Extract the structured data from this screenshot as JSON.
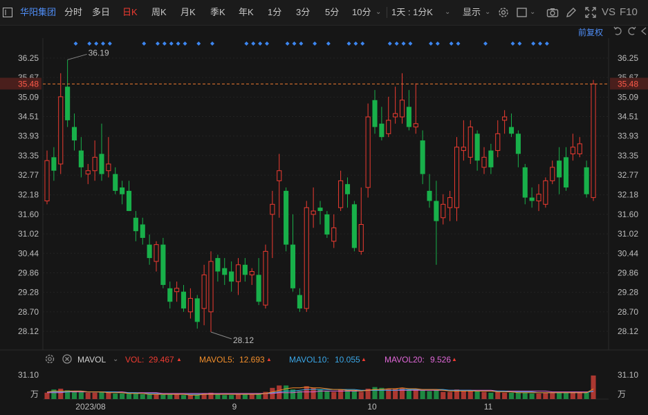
{
  "toolbar": {
    "stock_name": "华阳集团",
    "periods": [
      "分时",
      "多日",
      "日K",
      "周K",
      "月K",
      "季K",
      "年K",
      "1分",
      "3分",
      "5分",
      "10分"
    ],
    "active_period": "日K",
    "interval_select": "1天 : 1分K",
    "display_label": "显示",
    "compare_label": "VS",
    "f10_label": "F10"
  },
  "adjust_label": "前复权",
  "price_axis": {
    "ticks": [
      "36.25",
      "35.67",
      "35.09",
      "34.51",
      "33.93",
      "33.35",
      "32.77",
      "32.18",
      "31.60",
      "31.02",
      "30.44",
      "29.86",
      "29.28",
      "28.70",
      "28.12"
    ],
    "current_price": "35.48",
    "high_label": "36.19",
    "low_label": "28.12"
  },
  "volume_panel": {
    "indicator": "MAVOL",
    "vol_label": "VOL:",
    "vol_value": "29.467",
    "mavol5_label": "MAVOL5:",
    "mavol5_value": "12.693",
    "mavol10_label": "MAVOL10:",
    "mavol10_value": "10.055",
    "mavol20_label": "MAVOL20:",
    "mavol20_value": "9.526",
    "axis_top": "31.10",
    "axis_unit": "万"
  },
  "x_axis": [
    "2023/08",
    "9",
    "10",
    "11"
  ],
  "colors": {
    "up": "#ef3b31",
    "down": "#18b04a",
    "mavol5": "#f28e2b",
    "mavol10": "#3aa7e8",
    "mavol20": "#e067d8"
  },
  "chart_data": {
    "type": "candlestick",
    "ylim": [
      27.9,
      36.6
    ],
    "candles": [
      {
        "o": 32.0,
        "c": 33.2,
        "h": 33.5,
        "l": 31.9
      },
      {
        "o": 33.3,
        "c": 32.9,
        "h": 33.6,
        "l": 32.6
      },
      {
        "o": 33.1,
        "c": 35.1,
        "h": 35.8,
        "l": 32.8
      },
      {
        "o": 35.4,
        "c": 34.4,
        "h": 36.2,
        "l": 34.2
      },
      {
        "o": 34.2,
        "c": 33.8,
        "h": 34.6,
        "l": 33.5
      },
      {
        "o": 33.5,
        "c": 33.0,
        "h": 33.9,
        "l": 32.7
      },
      {
        "o": 32.8,
        "c": 32.9,
        "h": 33.1,
        "l": 32.5
      },
      {
        "o": 32.9,
        "c": 33.3,
        "h": 33.8,
        "l": 32.6
      },
      {
        "o": 33.4,
        "c": 32.8,
        "h": 34.3,
        "l": 32.6
      },
      {
        "o": 32.9,
        "c": 33.1,
        "h": 33.9,
        "l": 32.7
      },
      {
        "o": 32.8,
        "c": 32.3,
        "h": 33.0,
        "l": 32.2
      },
      {
        "o": 32.4,
        "c": 32.2,
        "h": 32.6,
        "l": 31.9
      },
      {
        "o": 32.3,
        "c": 31.7,
        "h": 32.6,
        "l": 31.7
      },
      {
        "o": 31.5,
        "c": 31.1,
        "h": 31.7,
        "l": 30.8
      },
      {
        "o": 31.3,
        "c": 30.9,
        "h": 31.5,
        "l": 30.7
      },
      {
        "o": 30.7,
        "c": 30.3,
        "h": 31.0,
        "l": 30.1
      },
      {
        "o": 30.2,
        "c": 30.7,
        "h": 30.8,
        "l": 29.9
      },
      {
        "o": 30.7,
        "c": 29.5,
        "h": 30.9,
        "l": 29.4
      },
      {
        "o": 29.4,
        "c": 29.0,
        "h": 29.6,
        "l": 28.8
      },
      {
        "o": 29.3,
        "c": 29.4,
        "h": 29.6,
        "l": 29.0
      },
      {
        "o": 29.3,
        "c": 28.8,
        "h": 29.5,
        "l": 28.7
      },
      {
        "o": 28.7,
        "c": 29.1,
        "h": 29.4,
        "l": 28.5
      },
      {
        "o": 29.1,
        "c": 28.4,
        "h": 29.2,
        "l": 28.2
      },
      {
        "o": 28.8,
        "c": 29.8,
        "h": 30.1,
        "l": 28.3
      },
      {
        "o": 28.7,
        "c": 30.2,
        "h": 30.5,
        "l": 28.1
      },
      {
        "o": 30.3,
        "c": 29.9,
        "h": 30.4,
        "l": 29.6
      },
      {
        "o": 30.0,
        "c": 29.8,
        "h": 30.3,
        "l": 29.5
      },
      {
        "o": 29.9,
        "c": 29.6,
        "h": 30.2,
        "l": 29.3
      },
      {
        "o": 29.6,
        "c": 30.1,
        "h": 30.3,
        "l": 29.2
      },
      {
        "o": 30.1,
        "c": 29.8,
        "h": 30.3,
        "l": 29.6
      },
      {
        "o": 29.8,
        "c": 29.9,
        "h": 30.0,
        "l": 29.5
      },
      {
        "o": 29.8,
        "c": 29.0,
        "h": 30.3,
        "l": 28.9
      },
      {
        "o": 28.9,
        "c": 30.5,
        "h": 30.7,
        "l": 28.8
      },
      {
        "o": 31.6,
        "c": 31.9,
        "h": 32.3,
        "l": 30.3
      },
      {
        "o": 32.6,
        "c": 32.9,
        "h": 33.4,
        "l": 31.5
      },
      {
        "o": 32.3,
        "c": 30.7,
        "h": 32.4,
        "l": 30.5
      },
      {
        "o": 30.7,
        "c": 29.4,
        "h": 31.6,
        "l": 29.3
      },
      {
        "o": 29.2,
        "c": 28.8,
        "h": 29.4,
        "l": 28.7
      },
      {
        "o": 28.8,
        "c": 31.8,
        "h": 32.0,
        "l": 28.7
      },
      {
        "o": 31.6,
        "c": 31.7,
        "h": 32.4,
        "l": 31.2
      },
      {
        "o": 31.8,
        "c": 31.7,
        "h": 32.0,
        "l": 31.3
      },
      {
        "o": 31.6,
        "c": 31.0,
        "h": 31.7,
        "l": 30.9
      },
      {
        "o": 30.8,
        "c": 31.2,
        "h": 31.6,
        "l": 30.6
      },
      {
        "o": 31.8,
        "c": 32.6,
        "h": 32.9,
        "l": 31.7
      },
      {
        "o": 32.5,
        "c": 32.2,
        "h": 32.7,
        "l": 31.8
      },
      {
        "o": 31.9,
        "c": 30.6,
        "h": 32.0,
        "l": 30.5
      },
      {
        "o": 30.5,
        "c": 31.3,
        "h": 32.4,
        "l": 30.4
      },
      {
        "o": 32.4,
        "c": 34.5,
        "h": 34.9,
        "l": 32.1
      },
      {
        "o": 35.0,
        "c": 34.2,
        "h": 35.3,
        "l": 34.0
      },
      {
        "o": 34.3,
        "c": 33.9,
        "h": 34.8,
        "l": 33.8
      },
      {
        "o": 34.0,
        "c": 34.4,
        "h": 35.1,
        "l": 33.9
      },
      {
        "o": 34.5,
        "c": 34.6,
        "h": 35.4,
        "l": 34.3
      },
      {
        "o": 34.5,
        "c": 35.0,
        "h": 35.8,
        "l": 34.3
      },
      {
        "o": 34.8,
        "c": 34.2,
        "h": 35.3,
        "l": 34.1
      },
      {
        "o": 34.2,
        "c": 34.3,
        "h": 35.5,
        "l": 34.0
      },
      {
        "o": 33.8,
        "c": 32.8,
        "h": 34.1,
        "l": 32.5
      },
      {
        "o": 32.3,
        "c": 32.0,
        "h": 32.8,
        "l": 31.8
      },
      {
        "o": 32.0,
        "c": 31.4,
        "h": 32.6,
        "l": 30.1
      },
      {
        "o": 31.5,
        "c": 31.9,
        "h": 32.2,
        "l": 31.3
      },
      {
        "o": 31.8,
        "c": 32.1,
        "h": 32.3,
        "l": 31.4
      },
      {
        "o": 31.8,
        "c": 33.6,
        "h": 33.9,
        "l": 31.4
      },
      {
        "o": 33.5,
        "c": 33.6,
        "h": 34.4,
        "l": 33.2
      },
      {
        "o": 33.3,
        "c": 34.2,
        "h": 34.4,
        "l": 33.1
      },
      {
        "o": 34.0,
        "c": 33.2,
        "h": 34.1,
        "l": 32.9
      },
      {
        "o": 33.0,
        "c": 33.3,
        "h": 33.6,
        "l": 32.8
      },
      {
        "o": 33.5,
        "c": 33.0,
        "h": 33.7,
        "l": 32.8
      },
      {
        "o": 33.5,
        "c": 34.0,
        "h": 34.4,
        "l": 33.3
      },
      {
        "o": 34.4,
        "c": 34.5,
        "h": 34.7,
        "l": 34.0
      },
      {
        "o": 34.2,
        "c": 34.0,
        "h": 34.6,
        "l": 33.9
      },
      {
        "o": 34.0,
        "c": 33.4,
        "h": 34.1,
        "l": 33.0
      },
      {
        "o": 33.0,
        "c": 32.1,
        "h": 33.1,
        "l": 31.9
      },
      {
        "o": 32.1,
        "c": 32.0,
        "h": 32.4,
        "l": 31.8
      },
      {
        "o": 32.0,
        "c": 32.2,
        "h": 32.5,
        "l": 31.7
      },
      {
        "o": 31.9,
        "c": 32.6,
        "h": 32.7,
        "l": 31.8
      },
      {
        "o": 32.6,
        "c": 33.0,
        "h": 33.2,
        "l": 32.5
      },
      {
        "o": 33.2,
        "c": 32.7,
        "h": 33.6,
        "l": 32.2
      },
      {
        "o": 33.3,
        "c": 32.4,
        "h": 33.6,
        "l": 32.3
      },
      {
        "o": 33.4,
        "c": 33.6,
        "h": 34.0,
        "l": 33.2
      },
      {
        "o": 33.4,
        "c": 33.7,
        "h": 33.9,
        "l": 33.3
      },
      {
        "o": 33.0,
        "c": 32.2,
        "h": 33.2,
        "l": 32.1
      },
      {
        "o": 32.1,
        "c": 35.48,
        "h": 35.6,
        "l": 32.0
      }
    ],
    "volume": {
      "ylim": [
        0,
        31.1
      ],
      "values": [
        8,
        12,
        13,
        11,
        10,
        9,
        8,
        8,
        9,
        8,
        7,
        7,
        7,
        7,
        6,
        6,
        6,
        6,
        6,
        6,
        5,
        5,
        5,
        7,
        8,
        6,
        5,
        5,
        6,
        6,
        6,
        7,
        9,
        14,
        17,
        17,
        12,
        10,
        16,
        14,
        12,
        10,
        9,
        12,
        11,
        10,
        9,
        13,
        15,
        14,
        13,
        13,
        14,
        12,
        12,
        11,
        10,
        11,
        9,
        9,
        12,
        10,
        11,
        10,
        9,
        8,
        9,
        8,
        8,
        8,
        8,
        7,
        7,
        8,
        8,
        8,
        8,
        9,
        9,
        8,
        29.467
      ],
      "mavol5": [
        9,
        10,
        10,
        10,
        10,
        10,
        9,
        9,
        9,
        8,
        8,
        8,
        7,
        7,
        7,
        6,
        6,
        6,
        6,
        6,
        6,
        5,
        5,
        6,
        6,
        6,
        6,
        6,
        6,
        6,
        6,
        6,
        7,
        9,
        11,
        13,
        14,
        14,
        15,
        14,
        14,
        13,
        12,
        12,
        11,
        11,
        10,
        11,
        12,
        12,
        13,
        13,
        14,
        13,
        13,
        12,
        12,
        12,
        11,
        10,
        10,
        10,
        10,
        10,
        10,
        10,
        9,
        9,
        9,
        8,
        8,
        8,
        8,
        8,
        8,
        8,
        8,
        8,
        8,
        8,
        12.693
      ],
      "mavol10": [
        9,
        9,
        9,
        9,
        10,
        10,
        9,
        9,
        9,
        9,
        9,
        8,
        8,
        8,
        7,
        7,
        7,
        6,
        6,
        6,
        6,
        6,
        6,
        6,
        6,
        6,
        6,
        6,
        6,
        6,
        6,
        6,
        7,
        8,
        9,
        10,
        10,
        11,
        12,
        12,
        12,
        12,
        12,
        12,
        12,
        12,
        11,
        11,
        11,
        11,
        11,
        11,
        12,
        12,
        12,
        12,
        12,
        12,
        12,
        11,
        11,
        11,
        11,
        10,
        10,
        10,
        10,
        10,
        9,
        9,
        9,
        9,
        8,
        8,
        8,
        8,
        8,
        8,
        8,
        8,
        10.055
      ],
      "mavol20": [
        8,
        8,
        8,
        9,
        9,
        9,
        9,
        9,
        9,
        9,
        9,
        9,
        8,
        8,
        8,
        8,
        8,
        7,
        7,
        7,
        7,
        7,
        7,
        7,
        7,
        7,
        7,
        7,
        7,
        7,
        7,
        7,
        7,
        7,
        8,
        8,
        8,
        9,
        9,
        9,
        10,
        10,
        10,
        10,
        10,
        10,
        10,
        11,
        11,
        11,
        11,
        11,
        11,
        11,
        11,
        11,
        11,
        11,
        11,
        11,
        11,
        11,
        11,
        11,
        11,
        11,
        10,
        10,
        10,
        10,
        10,
        10,
        10,
        10,
        9,
        9,
        9,
        9,
        9,
        9,
        9.526
      ]
    },
    "info_markers": [
      4,
      6,
      7,
      8,
      9,
      14,
      16,
      17,
      18,
      19,
      20,
      22,
      24,
      29,
      30,
      31,
      32,
      35,
      36,
      37,
      39,
      41,
      44,
      45,
      46,
      50,
      51,
      52,
      53,
      56,
      57,
      59,
      60,
      64,
      68,
      69,
      71,
      72,
      73
    ]
  }
}
